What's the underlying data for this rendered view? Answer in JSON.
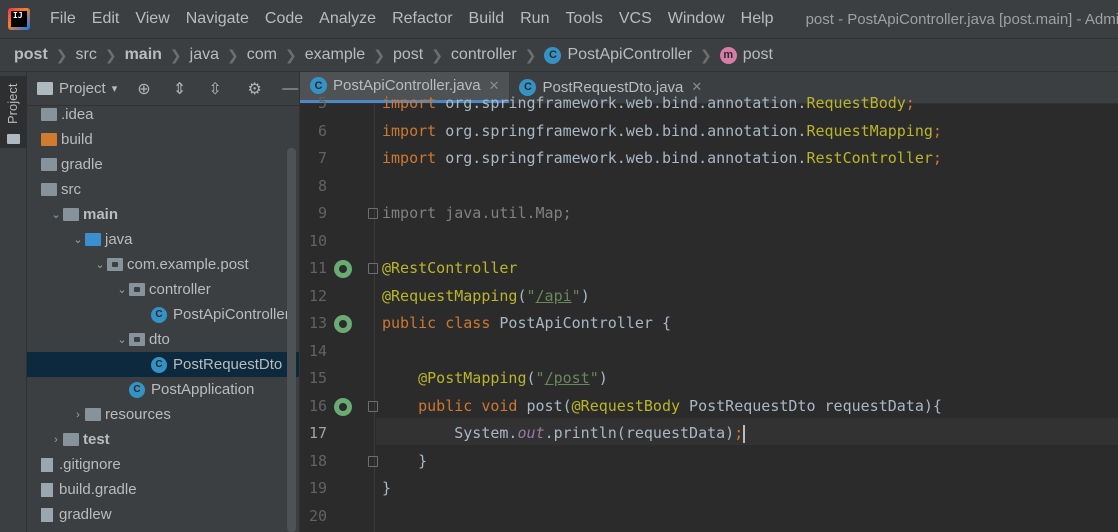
{
  "menubar": {
    "logo": "IJ",
    "items": [
      "File",
      "Edit",
      "View",
      "Navigate",
      "Code",
      "Analyze",
      "Refactor",
      "Build",
      "Run",
      "Tools",
      "VCS",
      "Window",
      "Help"
    ],
    "window_title": "post - PostApiController.java [post.main] - Adminis"
  },
  "breadcrumb": [
    "post",
    "src",
    "main",
    "java",
    "com",
    "example",
    "post",
    "controller",
    "PostApiController",
    "post"
  ],
  "project_panel": {
    "title": "Project",
    "stripe_label": "Project",
    "tree": [
      {
        "label": ".idea",
        "depth": 0,
        "kind": "folder"
      },
      {
        "label": "build",
        "depth": 0,
        "kind": "folder-orange"
      },
      {
        "label": "gradle",
        "depth": 0,
        "kind": "folder"
      },
      {
        "label": "src",
        "depth": 0,
        "kind": "folder"
      },
      {
        "label": "main",
        "depth": 1,
        "kind": "folder",
        "expanded": true,
        "bold": true
      },
      {
        "label": "java",
        "depth": 2,
        "kind": "folder-blue",
        "expanded": true
      },
      {
        "label": "com.example.post",
        "depth": 3,
        "kind": "package",
        "expanded": true
      },
      {
        "label": "controller",
        "depth": 4,
        "kind": "package",
        "expanded": true
      },
      {
        "label": "PostApiController",
        "depth": 5,
        "kind": "class"
      },
      {
        "label": "dto",
        "depth": 4,
        "kind": "package",
        "expanded": true
      },
      {
        "label": "PostRequestDto",
        "depth": 5,
        "kind": "class",
        "selected": true
      },
      {
        "label": "PostApplication",
        "depth": 4,
        "kind": "class"
      },
      {
        "label": "resources",
        "depth": 2,
        "kind": "folder",
        "expanded": false
      },
      {
        "label": "test",
        "depth": 1,
        "kind": "folder",
        "expanded": false,
        "bold": true
      },
      {
        "label": ".gitignore",
        "depth": 0,
        "kind": "file"
      },
      {
        "label": "build.gradle",
        "depth": 0,
        "kind": "file"
      },
      {
        "label": "gradlew",
        "depth": 0,
        "kind": "file"
      }
    ]
  },
  "editor": {
    "tabs": [
      {
        "label": "PostApiController.java",
        "active": true
      },
      {
        "label": "PostRequestDto.java",
        "active": false
      }
    ],
    "current_line": 17,
    "lines": [
      {
        "n": 5,
        "text": "import org.springframework.web.bind.annotation.RequestBody;"
      },
      {
        "n": 6,
        "text": "import org.springframework.web.bind.annotation.RequestMapping;"
      },
      {
        "n": 7,
        "text": "import org.springframework.web.bind.annotation.RestController;"
      },
      {
        "n": 8,
        "text": ""
      },
      {
        "n": 9,
        "text": "import java.util.Map;"
      },
      {
        "n": 10,
        "text": ""
      },
      {
        "n": 11,
        "text": "@RestController"
      },
      {
        "n": 12,
        "text": "@RequestMapping(\"/api\")"
      },
      {
        "n": 13,
        "text": "public class PostApiController {"
      },
      {
        "n": 14,
        "text": ""
      },
      {
        "n": 15,
        "text": "    @PostMapping(\"/post\")"
      },
      {
        "n": 16,
        "text": "    public void post(@RequestBody PostRequestDto requestData){"
      },
      {
        "n": 17,
        "text": "        System.out.println(requestData);"
      },
      {
        "n": 18,
        "text": "    }"
      },
      {
        "n": 19,
        "text": "}"
      },
      {
        "n": 20,
        "text": ""
      }
    ]
  },
  "colors": {
    "keyword": "#cc7832",
    "annotation": "#bbb529",
    "string": "#6a8759",
    "static_field": "#9876aa",
    "selection": "#0d293e",
    "accent": "#4a88c7"
  }
}
